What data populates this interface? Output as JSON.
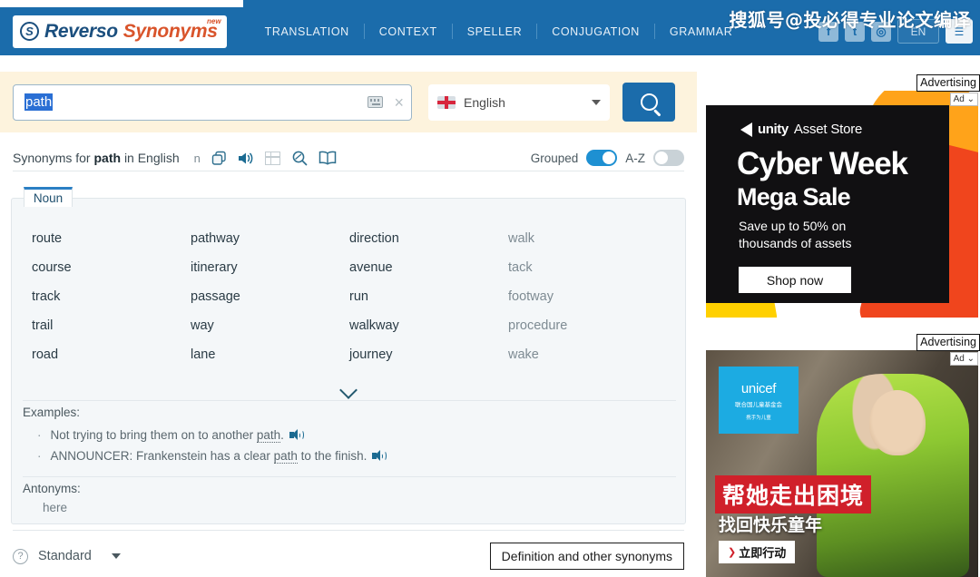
{
  "header": {
    "logo": {
      "icon": "reverso-s-icon",
      "word1": "Reverso",
      "word2": "Synonyms",
      "badge": "new"
    },
    "nav": [
      {
        "label": "TRANSLATION"
      },
      {
        "label": "CONTEXT"
      },
      {
        "label": "SPELLER"
      },
      {
        "label": "CONJUGATION"
      },
      {
        "label": "GRAMMAR"
      }
    ],
    "social": [
      {
        "name": "facebook-icon",
        "glyph": "f"
      },
      {
        "name": "twitter-icon",
        "glyph": "t"
      },
      {
        "name": "instagram-icon",
        "glyph": "◎"
      }
    ],
    "lang_button": "EN",
    "menu_button": "☰",
    "watermark": "搜狐号@投必得专业论文编译"
  },
  "search": {
    "value": "path",
    "placeholder": "",
    "keyboard_icon": "virtual-keyboard-icon",
    "clear_icon": "×",
    "language": "English",
    "flag": "uk-flag-icon",
    "search_icon": "search-icon"
  },
  "toolbar": {
    "title_prefix": "Synonyms for",
    "title_word": "path",
    "title_suffix": "in English",
    "pos_marker": "n",
    "icons": [
      {
        "name": "copy-icon"
      },
      {
        "name": "speaker-icon"
      },
      {
        "name": "table-icon"
      },
      {
        "name": "search-definition-icon"
      },
      {
        "name": "dictionary-book-icon"
      }
    ],
    "grouped_label": "Grouped",
    "grouped_on": true,
    "az_label": "A-Z",
    "az_on": false
  },
  "results": {
    "pos_tab": "Noun",
    "columns": [
      {
        "words": [
          "route",
          "course",
          "track",
          "trail",
          "road"
        ],
        "dim": false
      },
      {
        "words": [
          "pathway",
          "itinerary",
          "passage",
          "way",
          "lane"
        ],
        "dim": false
      },
      {
        "words": [
          "direction",
          "avenue",
          "run",
          "walkway",
          "journey"
        ],
        "dim": false
      },
      {
        "words": [
          "walk",
          "tack",
          "footway",
          "procedure",
          "wake"
        ],
        "dim": true
      }
    ],
    "expand_icon": "chevron-down-icon",
    "examples_label": "Examples:",
    "examples": [
      {
        "pre": "Not trying to bring them on to another ",
        "word": "path",
        "post": "."
      },
      {
        "pre": "ANNOUNCER: Frankenstein has a clear ",
        "word": "path",
        "post": " to the finish."
      }
    ],
    "antonyms_label": "Antonyms:",
    "antonyms": [
      "here"
    ]
  },
  "footer": {
    "help_icon": "?",
    "mode_label": "Standard",
    "definition_button": "Definition and other synonyms"
  },
  "ads": [
    {
      "label": "Advertising",
      "badge": "Ad ⌄",
      "brand_part1": "unity",
      "brand_part2": "Asset Store",
      "headline1": "Cyber Week",
      "headline2": "Mega Sale",
      "subline1": "Save up to 50% on",
      "subline2": "thousands of assets",
      "cta": "Shop now"
    },
    {
      "label": "Advertising",
      "badge": "Ad ⌄",
      "logo_text": "unicef",
      "logo_cn1": "联合国儿童基金会",
      "logo_cn2": "携手为儿童",
      "headline": "帮她走出困境",
      "subline": "找回快乐童年",
      "cta_arrow": "❯",
      "cta": "立即行动"
    }
  ]
}
